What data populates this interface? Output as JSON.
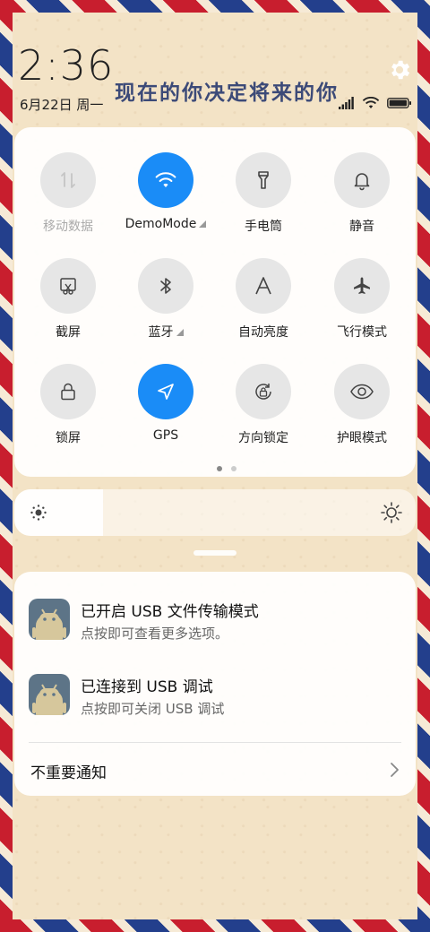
{
  "status": {
    "time": "2:36",
    "date": "6月22日 周一",
    "motto": "现在的你决定将来的你"
  },
  "quick_settings": {
    "tiles": [
      {
        "label": "移动数据",
        "icon": "mobile-data-icon",
        "state": "disabled"
      },
      {
        "label": "DemoMode",
        "icon": "wifi-icon",
        "state": "on"
      },
      {
        "label": "手电筒",
        "icon": "flashlight-icon",
        "state": "off"
      },
      {
        "label": "静音",
        "icon": "bell-icon",
        "state": "off"
      },
      {
        "label": "截屏",
        "icon": "screenshot-icon",
        "state": "off"
      },
      {
        "label": "蓝牙",
        "icon": "bluetooth-icon",
        "state": "off"
      },
      {
        "label": "自动亮度",
        "icon": "auto-brightness-icon",
        "state": "off"
      },
      {
        "label": "飞行模式",
        "icon": "airplane-icon",
        "state": "off"
      },
      {
        "label": "锁屏",
        "icon": "lock-icon",
        "state": "off"
      },
      {
        "label": "GPS",
        "icon": "location-arrow-icon",
        "state": "on"
      },
      {
        "label": "方向锁定",
        "icon": "rotation-lock-icon",
        "state": "off"
      },
      {
        "label": "护眼模式",
        "icon": "eye-icon",
        "state": "off"
      }
    ],
    "page_count": 2,
    "current_page": 1
  },
  "brightness": {
    "level": 0.22
  },
  "notifications": [
    {
      "title": "已开启 USB 文件传输模式",
      "body": "点按即可查看更多选项。",
      "icon": "android-icon"
    },
    {
      "title": "已连接到 USB 调试",
      "body": "点按即可关闭 USB 调试",
      "icon": "android-icon"
    }
  ],
  "unimportant_label": "不重要通知",
  "colors": {
    "accent": "#1a8cf7",
    "envelope_red": "#c81e2e",
    "envelope_blue": "#233f8c"
  }
}
